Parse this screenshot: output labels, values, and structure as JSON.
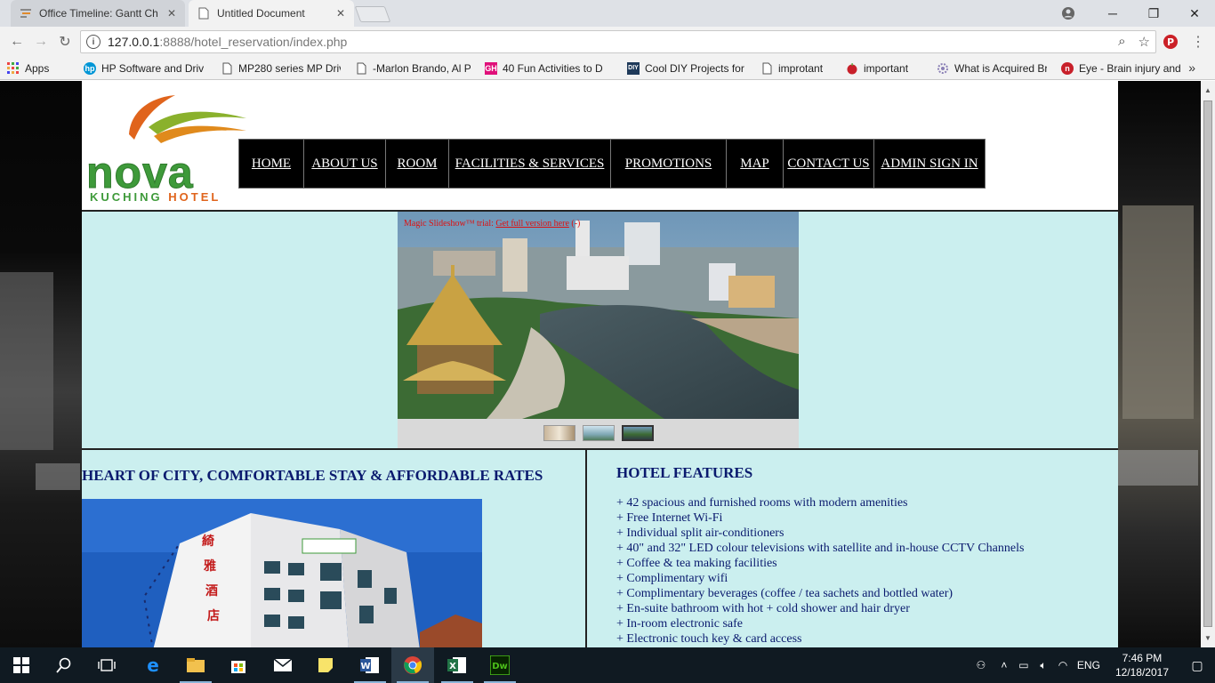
{
  "browser": {
    "tabs": [
      {
        "title": "Office Timeline: Gantt Ch",
        "active": false
      },
      {
        "title": "Untitled Document",
        "active": true
      }
    ],
    "url_host": "127.0.0.1",
    "url_path": ":8888/hotel_reservation/index.php",
    "bookmarks": [
      {
        "label": "Apps",
        "icon": "apps-grid-icon"
      },
      {
        "label": "HP Software and Driv",
        "icon": "hp-icon"
      },
      {
        "label": "MP280 series MP Driv",
        "icon": "page-icon"
      },
      {
        "label": "-Marlon Brando, Al Pa",
        "icon": "page-icon"
      },
      {
        "label": "40 Fun Activities to D",
        "icon": "gh-icon"
      },
      {
        "label": "Cool DIY Projects for",
        "icon": "diy-icon"
      },
      {
        "label": "improtant",
        "icon": "page-icon"
      },
      {
        "label": "important",
        "icon": "apple-icon"
      },
      {
        "label": "What is Acquired Brai",
        "icon": "gear-icon"
      },
      {
        "label": "Eye - Brain injury and",
        "icon": "n-icon"
      }
    ]
  },
  "site": {
    "logo": {
      "word": "nova",
      "sub_left": "KUCHING ",
      "sub_right": "HOTEL"
    },
    "nav": [
      "HOME",
      "ABOUT US",
      "ROOM",
      "FACILITIES & SERVICES",
      "PROMOTIONS",
      "MAP",
      "CONTACT US",
      "ADMIN SIGN IN"
    ],
    "slideshow": {
      "trial_text": "Magic Slideshow™ trial: ",
      "trial_link": "Get full version here",
      "trial_tail": " (-)",
      "active_thumb": 3,
      "thumb_count": 3
    },
    "left_heading": "HEART OF CITY, COMFORTABLE STAY & AFFORDABLE RATES",
    "right_heading": "HOTEL FEATURES",
    "features": [
      "+ 42 spacious and furnished rooms with modern amenities",
      "+ Free Internet Wi-Fi",
      "+ Individual split air-conditioners",
      "+ 40\" and 32\" LED colour televisions with satellite and in-house CCTV Channels",
      "+ Coffee & tea making facilities",
      "+ Complimentary wifi",
      "+ Complimentary beverages (coffee / tea sachets and bottled water)",
      "+ En-suite bathroom with hot + cold shower and hair dryer",
      "+ In-room electronic safe",
      "+ Electronic touch key & card access"
    ]
  },
  "taskbar": {
    "language": "ENG",
    "time": "7:46 PM",
    "date": "12/18/2017"
  },
  "colors": {
    "band_bg": "#cbefef",
    "nav_bg": "#000000",
    "heading_text": "#0a1a6e",
    "logo_green": "#3e9a3a",
    "logo_orange": "#e0641c"
  }
}
